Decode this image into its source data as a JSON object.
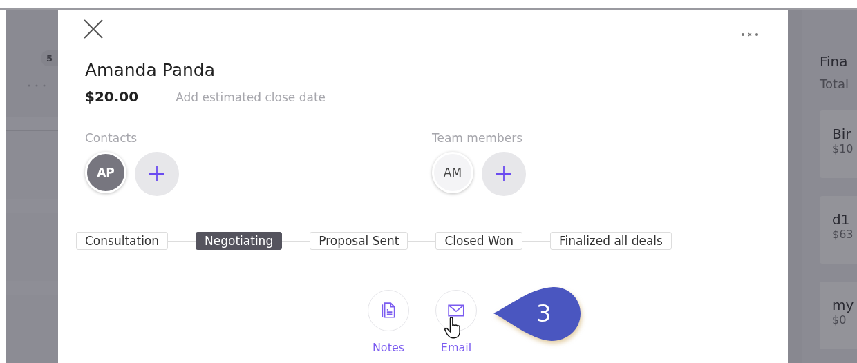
{
  "board": {
    "left_column": {
      "count": "5"
    },
    "right_column": {
      "title": "Fina",
      "subtitle": "Total",
      "cards": [
        {
          "title": "Bir",
          "amount": "$10"
        },
        {
          "title": "d1",
          "amount": "$63"
        },
        {
          "title": "my",
          "amount": "$0"
        }
      ]
    }
  },
  "deal": {
    "title": "Amanda Panda",
    "amount": "$20.00",
    "close_date_link": "Add estimated close date",
    "contacts": {
      "label": "Contacts",
      "avatars": [
        {
          "initials": "AP"
        }
      ]
    },
    "team_members": {
      "label": "Team members",
      "avatars": [
        {
          "initials": "AM"
        }
      ]
    },
    "stages": [
      {
        "label": "Consultation",
        "selected": false
      },
      {
        "label": "Negotiating",
        "selected": true
      },
      {
        "label": "Proposal Sent",
        "selected": false
      },
      {
        "label": "Closed Won",
        "selected": false
      },
      {
        "label": "Finalized all deals",
        "selected": false
      }
    ],
    "actions": [
      {
        "kind": "notes",
        "label": "Notes"
      },
      {
        "kind": "email",
        "label": "Email"
      }
    ]
  },
  "callout": {
    "label": "3"
  }
}
